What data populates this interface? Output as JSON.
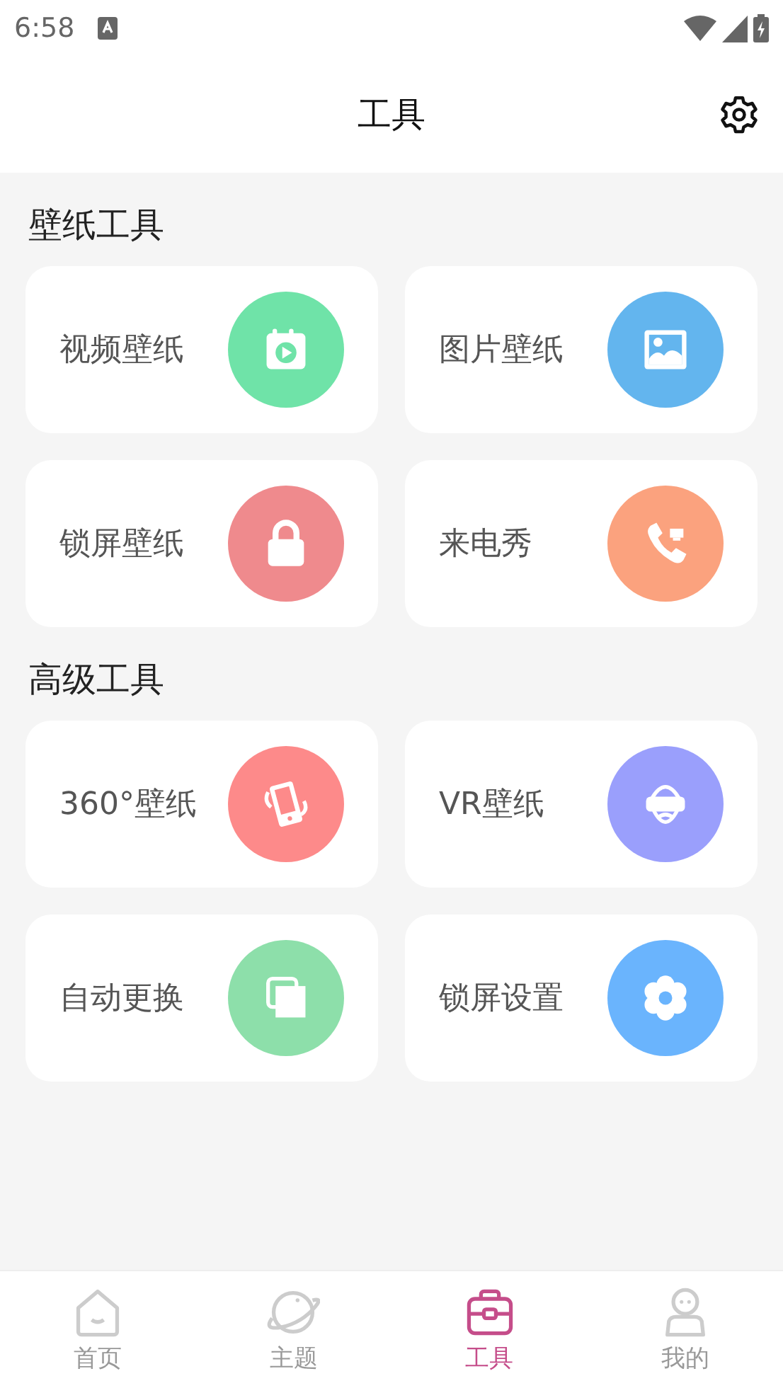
{
  "status_bar": {
    "time": "6:58"
  },
  "header": {
    "title": "工具"
  },
  "sections": [
    {
      "title": "壁纸工具",
      "tiles": [
        {
          "label": "视频壁纸",
          "kind": "video",
          "color": "#6fe3a8"
        },
        {
          "label": "图片壁纸",
          "kind": "image",
          "color": "#63b5ee"
        },
        {
          "label": "锁屏壁纸",
          "kind": "lock",
          "color": "#ef8a8d"
        },
        {
          "label": "来电秀",
          "kind": "phone",
          "color": "#fba27e"
        }
      ]
    },
    {
      "title": "高级工具",
      "tiles": [
        {
          "label": "360°壁纸",
          "kind": "rotate",
          "color": "#fd8a8a"
        },
        {
          "label": "VR壁纸",
          "kind": "vr",
          "color": "#9a9ffc"
        },
        {
          "label": "自动更换",
          "kind": "copy",
          "color": "#8ddfaa"
        },
        {
          "label": "锁屏设置",
          "kind": "flower",
          "color": "#6ab4fd"
        }
      ]
    }
  ],
  "bottom_nav": [
    {
      "label": "首页",
      "kind": "home",
      "selected": false
    },
    {
      "label": "主题",
      "kind": "planet",
      "selected": false
    },
    {
      "label": "工具",
      "kind": "toolbox",
      "selected": true
    },
    {
      "label": "我的",
      "kind": "person",
      "selected": false
    }
  ]
}
